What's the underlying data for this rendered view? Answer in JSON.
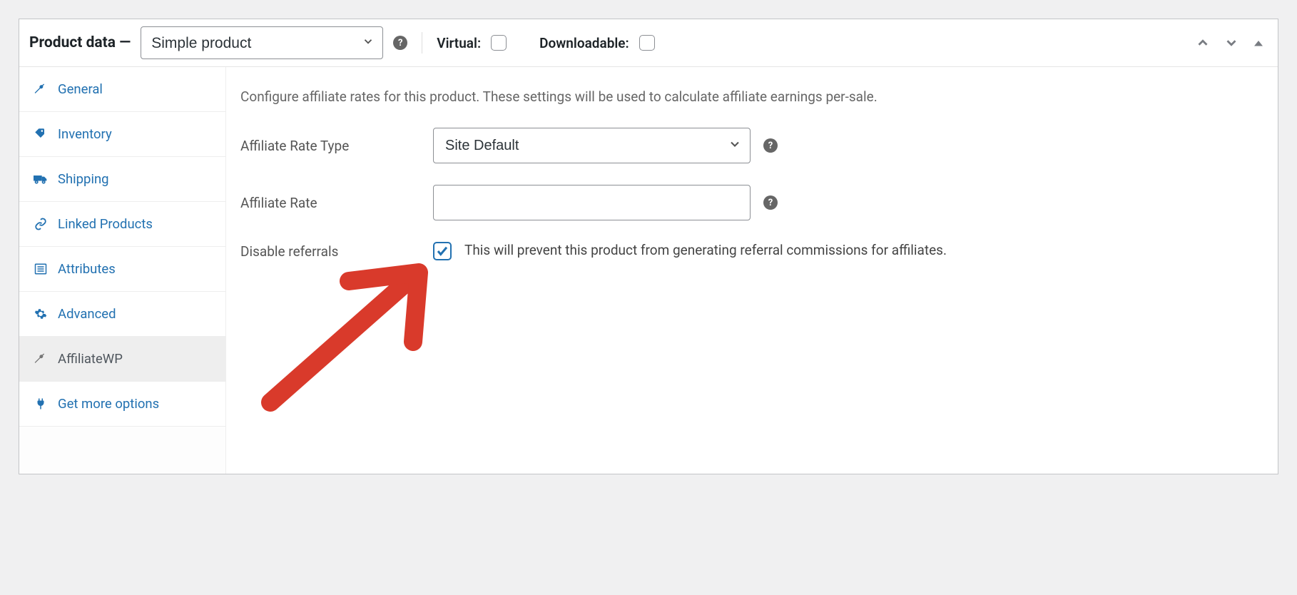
{
  "header": {
    "title": "Product data —",
    "product_type": "Simple product",
    "virtual_label": "Virtual:",
    "downloadable_label": "Downloadable:",
    "help_glyph": "?"
  },
  "sidebar": {
    "items": [
      {
        "id": "general",
        "label": "General",
        "icon": "wrench"
      },
      {
        "id": "inventory",
        "label": "Inventory",
        "icon": "tag"
      },
      {
        "id": "shipping",
        "label": "Shipping",
        "icon": "truck"
      },
      {
        "id": "linked",
        "label": "Linked Products",
        "icon": "link"
      },
      {
        "id": "attributes",
        "label": "Attributes",
        "icon": "list"
      },
      {
        "id": "advanced",
        "label": "Advanced",
        "icon": "gear"
      },
      {
        "id": "affiliatewp",
        "label": "AffiliateWP",
        "icon": "wrench",
        "active": true
      },
      {
        "id": "getmore",
        "label": "Get more options",
        "icon": "plug"
      }
    ]
  },
  "content": {
    "description": "Configure affiliate rates for this product. These settings will be used to calculate affiliate earnings per-sale.",
    "rate_type_label": "Affiliate Rate Type",
    "rate_type_value": "Site Default",
    "rate_label": "Affiliate Rate",
    "rate_value": "",
    "disable_label": "Disable referrals",
    "disable_checked": true,
    "disable_description": "This will prevent this product from generating referral commissions for affiliates."
  }
}
